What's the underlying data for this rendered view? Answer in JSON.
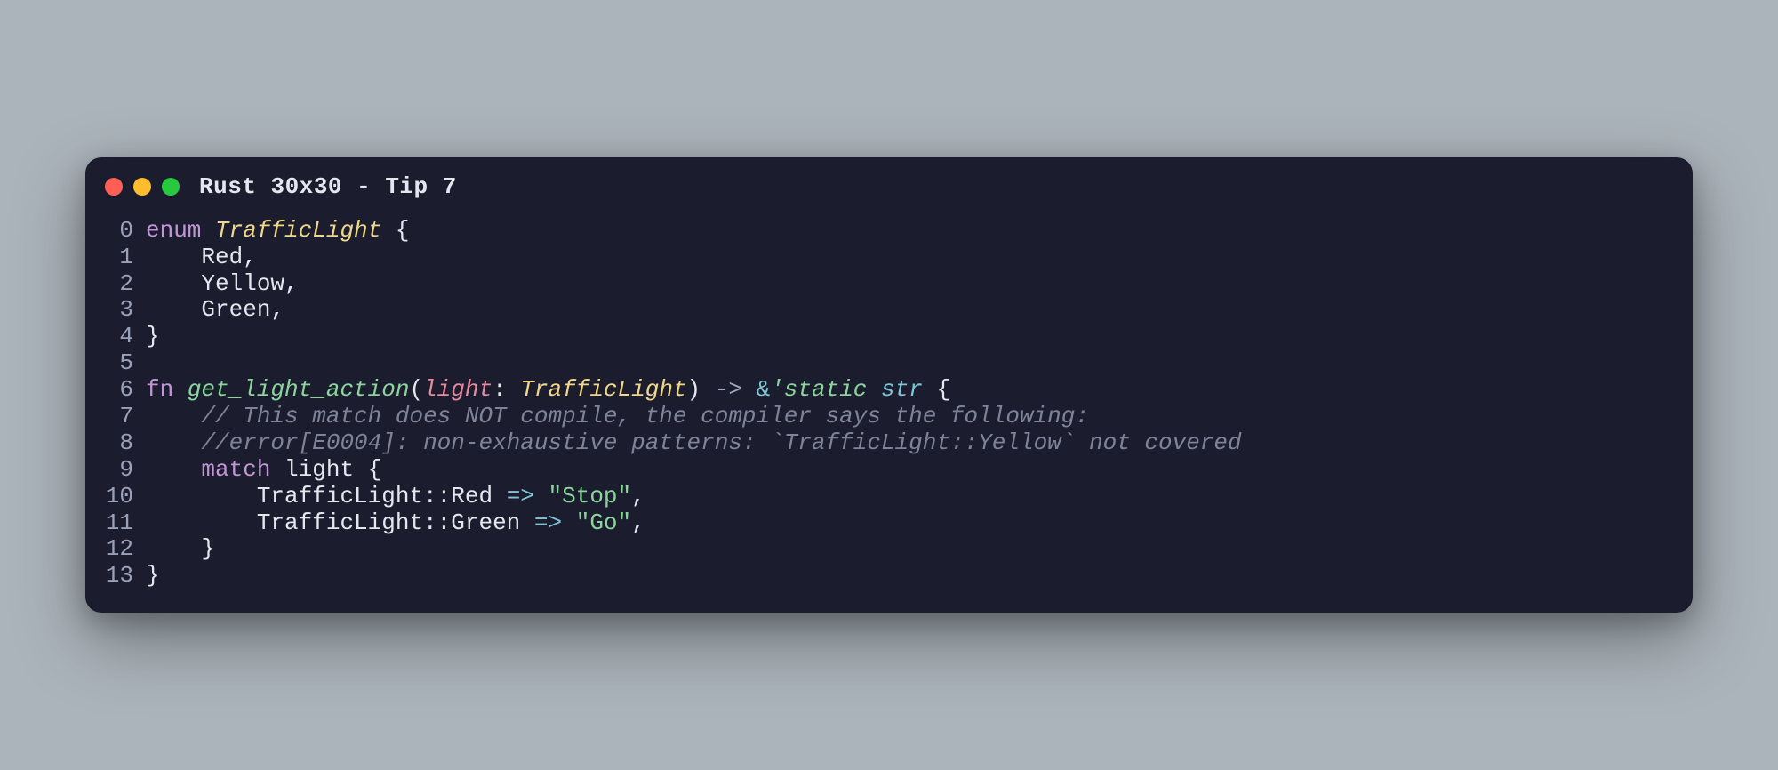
{
  "window": {
    "title": "Rust 30x30 - Tip 7"
  },
  "gutter": [
    "0",
    "1",
    "2",
    "3",
    "4",
    "5",
    "6",
    "7",
    "8",
    "9",
    "10",
    "11",
    "12",
    "13"
  ],
  "tokens": {
    "l0": {
      "enum": "enum",
      "sp": " ",
      "type": "TrafficLight",
      "sp2": " ",
      "brace": "{"
    },
    "l1": {
      "indent": "    ",
      "name": "Red",
      "comma": ","
    },
    "l2": {
      "indent": "    ",
      "name": "Yellow",
      "comma": ","
    },
    "l3": {
      "indent": "    ",
      "name": "Green",
      "comma": ","
    },
    "l4": {
      "brace": "}"
    },
    "l5": {
      "blank": ""
    },
    "l6": {
      "fn": "fn",
      "sp": " ",
      "name": "get_light_action",
      "open": "(",
      "param": "light",
      "colon": ": ",
      "ptype": "TrafficLight",
      "close": ") ",
      "arrow": "-> ",
      "amp": "&",
      "life": "'static",
      "sp2": " ",
      "str": "str",
      "sp3": " ",
      "brace": "{"
    },
    "l7": {
      "indent": "    ",
      "comment": "// This match does NOT compile, the compiler says the following:"
    },
    "l8": {
      "indent": "    ",
      "comment": "//error[E0004]: non-exhaustive patterns: `TrafficLight::Yellow` not covered"
    },
    "l9": {
      "indent": "    ",
      "match": "match",
      "sp": " ",
      "var": "light",
      "sp2": " ",
      "brace": "{"
    },
    "l10": {
      "indent": "        ",
      "enum": "TrafficLight::Red",
      "sp": " ",
      "arrow": "=>",
      "sp2": " ",
      "str": "\"Stop\"",
      "comma": ","
    },
    "l11": {
      "indent": "        ",
      "enum": "TrafficLight::Green",
      "sp": " ",
      "arrow": "=>",
      "sp2": " ",
      "str": "\"Go\"",
      "comma": ","
    },
    "l12": {
      "indent": "    ",
      "brace": "}"
    },
    "l13": {
      "brace": "}"
    }
  }
}
